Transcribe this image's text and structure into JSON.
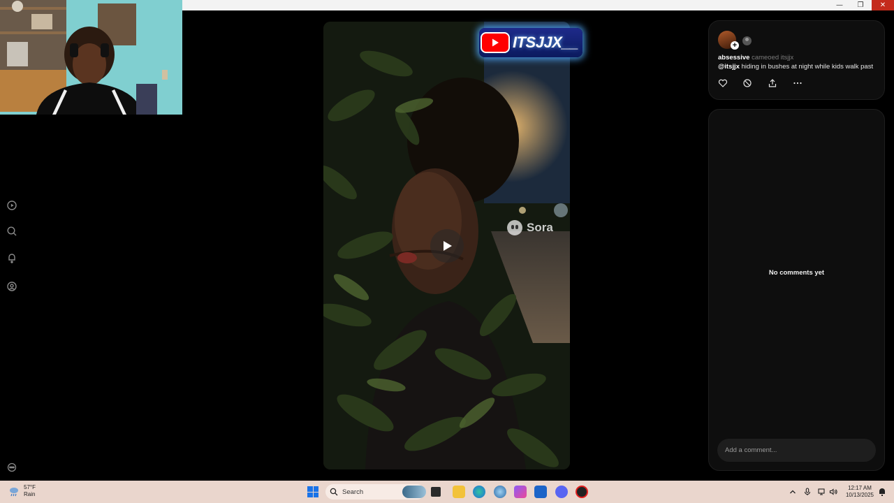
{
  "window": {
    "minimize_icon": "minimize-icon",
    "restore_icon": "restore-icon",
    "close_icon": "close-icon"
  },
  "nav_rail": {
    "items": [
      {
        "icon": "play-circle-icon"
      },
      {
        "icon": "search-icon"
      },
      {
        "icon": "bell-icon"
      },
      {
        "icon": "profile-icon"
      }
    ],
    "bottom_icon": "more-options-circle-icon"
  },
  "overlay": {
    "channel_name": "ITSJJX__",
    "brand_color": "#ff0000"
  },
  "video": {
    "watermark": "Sora",
    "state": "paused"
  },
  "post": {
    "author": "absessive",
    "action_text": "cameoed itsjjx",
    "mention": "@itsjjx",
    "caption": "hiding in bushes at night while kids walk past",
    "actions": [
      "heart-icon",
      "remix-icon",
      "share-icon",
      "more-icon"
    ]
  },
  "comments": {
    "empty_text": "No comments yet",
    "placeholder": "Add a comment..."
  },
  "taskbar": {
    "weather_temp": "57°F",
    "weather_desc": "Rain",
    "search_label": "Search",
    "time": "12:17 AM",
    "date": "10/13/2025",
    "accent": "#1a73e8"
  }
}
